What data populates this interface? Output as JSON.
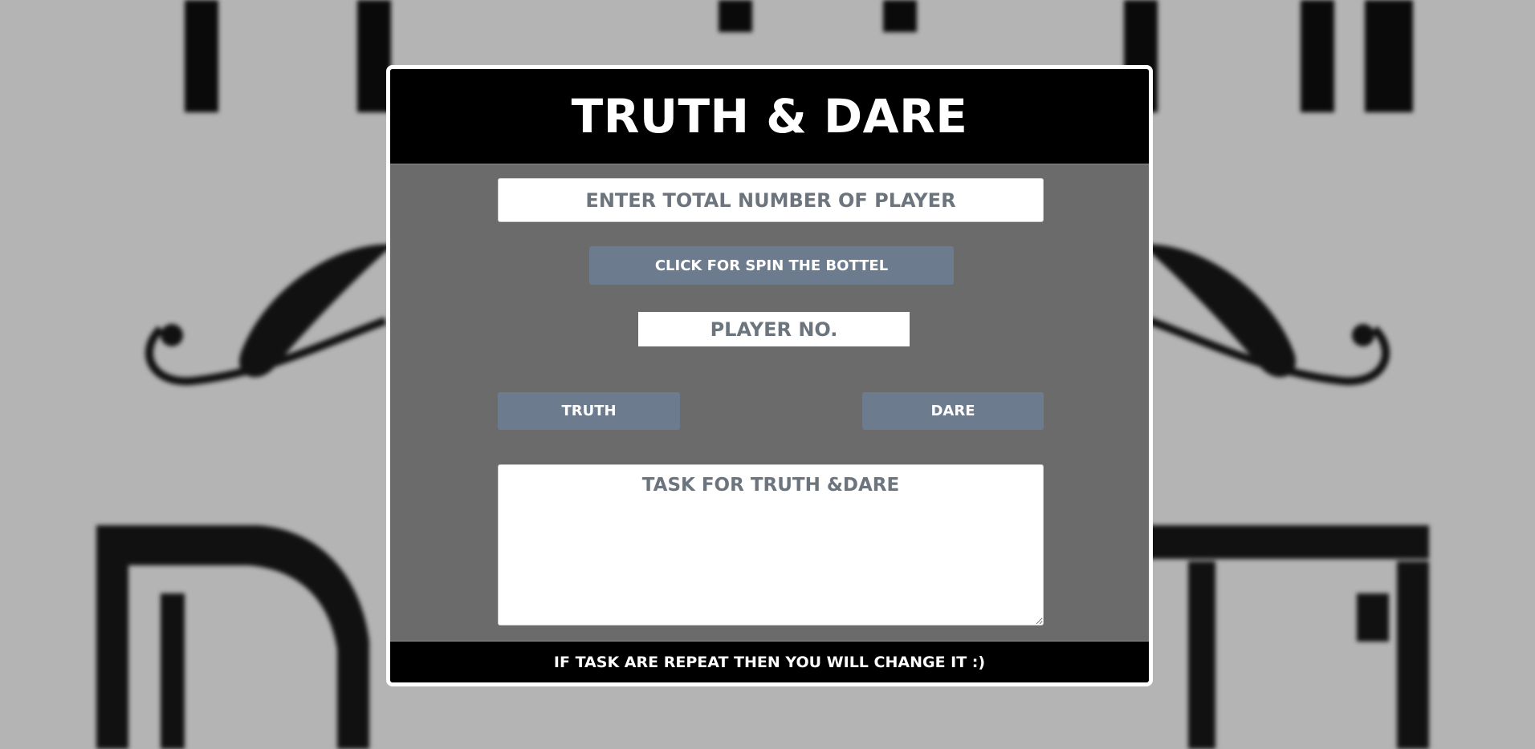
{
  "header": {
    "title": "TRUTH & DARE"
  },
  "players_input": {
    "placeholder": "ENTER TOTAL NUMBER OF PLAYER",
    "value": ""
  },
  "spin_button": {
    "label": "CLICK FOR SPIN THE BOTTEL"
  },
  "player_no": {
    "label": "PLAYER NO."
  },
  "choice_buttons": {
    "truth_label": "TRUTH",
    "dare_label": "DARE"
  },
  "task_area": {
    "placeholder": "TASK FOR TRUTH &DARE",
    "value": ""
  },
  "footer": {
    "note": "IF TASK ARE REPEAT THEN YOU WILL CHANGE IT :)"
  },
  "colors": {
    "background": "#b4b4b4",
    "card_body": "#6b6b6b",
    "header_footer": "#000000",
    "button": "#6c7c8e",
    "placeholder_text": "#6c757d"
  },
  "icons": {
    "resize_handle": "textarea-resize-grip-icon"
  }
}
